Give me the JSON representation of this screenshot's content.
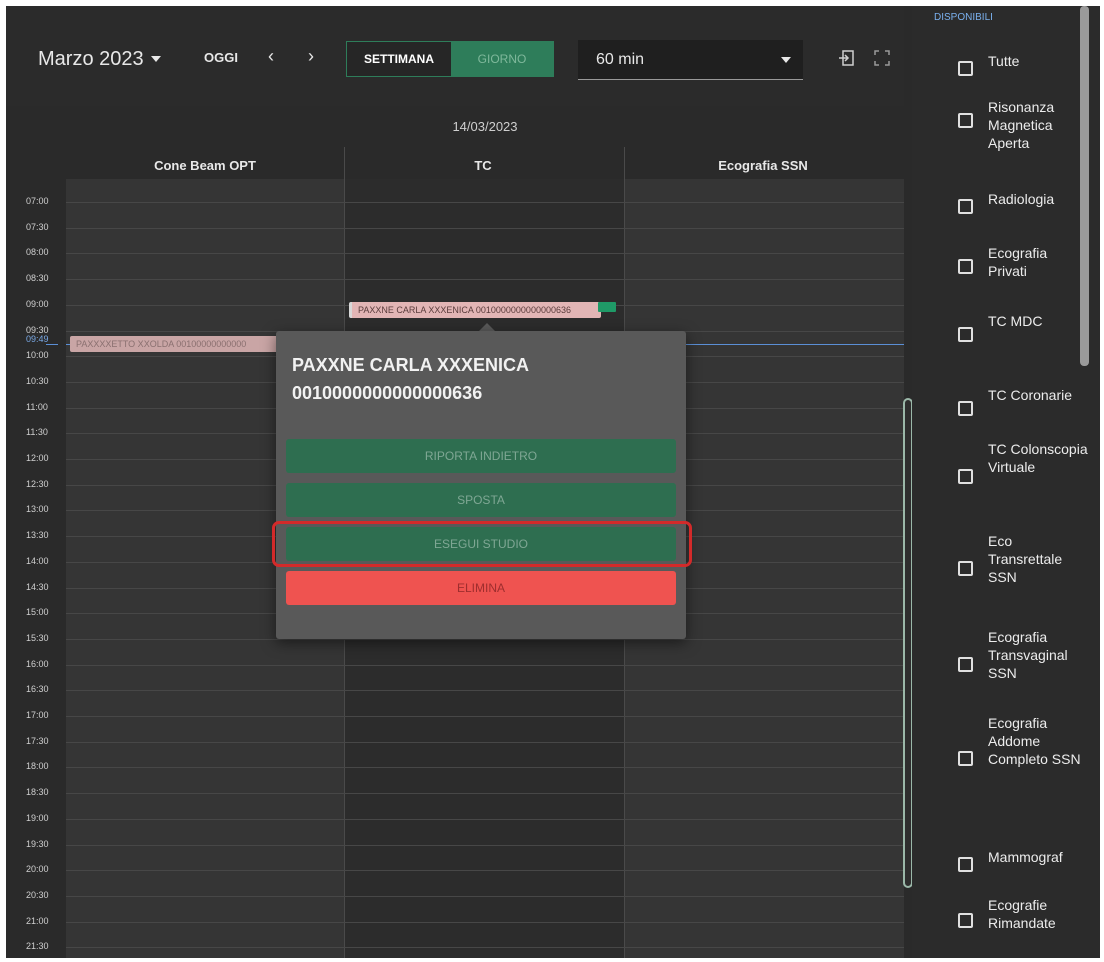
{
  "toolbar": {
    "month": "Marzo 2023",
    "today_label": "OGGI",
    "prev_label": "‹",
    "next_label": "›",
    "week_label": "SETTIMANA",
    "day_label": "GIORNO",
    "interval_value": "60 min"
  },
  "calendar": {
    "date": "14/03/2023",
    "columns": [
      "Cone Beam OPT",
      "TC",
      "Ecografia SSN"
    ],
    "times": [
      "07:00",
      "07:30",
      "08:00",
      "08:30",
      "09:00",
      "09:30",
      "10:00",
      "10:30",
      "11:00",
      "11:30",
      "12:00",
      "12:30",
      "13:00",
      "13:30",
      "14:00",
      "14:30",
      "15:00",
      "15:30",
      "16:00",
      "16:30",
      "17:00",
      "17:30",
      "18:00",
      "18:30",
      "19:00",
      "19:30",
      "20:00",
      "20:30",
      "21:00",
      "21:30"
    ],
    "now_time": "09:49",
    "events": {
      "left": "PAXXXXETTO XXOLDA 00100000000000",
      "tc": "PAXXNE CARLA XXXENICA 0010000000000000636"
    }
  },
  "popup": {
    "title": "PAXXNE CARLA XXXENICA 0010000000000000636",
    "buttons": [
      "RIPORTA INDIETRO",
      "SPOSTA",
      "ESEGUI STUDIO",
      "ELIMINA"
    ]
  },
  "panel": {
    "title": "DISPONIBILI",
    "filters": [
      "Tutte",
      "Risonanza Magnetica Aperta",
      "Radiologia",
      "Ecografia Privati",
      "TC MDC",
      "TC Coronarie",
      "TC Colonscopia Virtuale",
      "Eco Transrettale SSN",
      "Ecografia Transvaginal SSN",
      "Ecografia Addome Completo SSN",
      "Mammograf",
      "Ecografie Rimandate"
    ]
  }
}
